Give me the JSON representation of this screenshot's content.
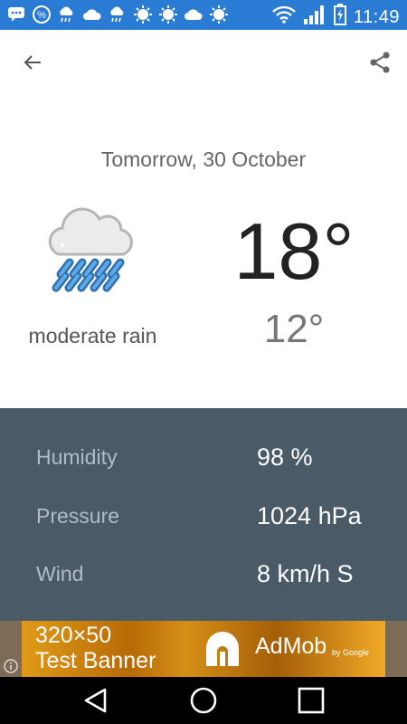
{
  "status_bar": {
    "time": "11:49",
    "icons_left": [
      "chat-icon",
      "percent-icon",
      "cloud-rain-icon",
      "cloud-icon",
      "cloud-rain-icon",
      "sun-icon",
      "sun-icon",
      "cloud-icon",
      "sun-icon"
    ],
    "icons_right": [
      "wifi-icon",
      "signal-icon",
      "battery-charging-icon"
    ],
    "accent": "#2a7bd3"
  },
  "forecast": {
    "date": "Tomorrow, 30 October",
    "condition": "moderate rain",
    "temp_high": "18°",
    "temp_low": "12°",
    "icon": "cloud-rain-icon"
  },
  "details": [
    {
      "label": "Humidity",
      "value": "98 %"
    },
    {
      "label": "Pressure",
      "value": "1024 hPa"
    },
    {
      "label": "Wind",
      "value": "8 km/h S"
    }
  ],
  "details_bg": "#4a5a66",
  "ad": {
    "size_text": "320×50",
    "test_text": "Test Banner",
    "brand": "AdMob",
    "by": "by Google"
  }
}
